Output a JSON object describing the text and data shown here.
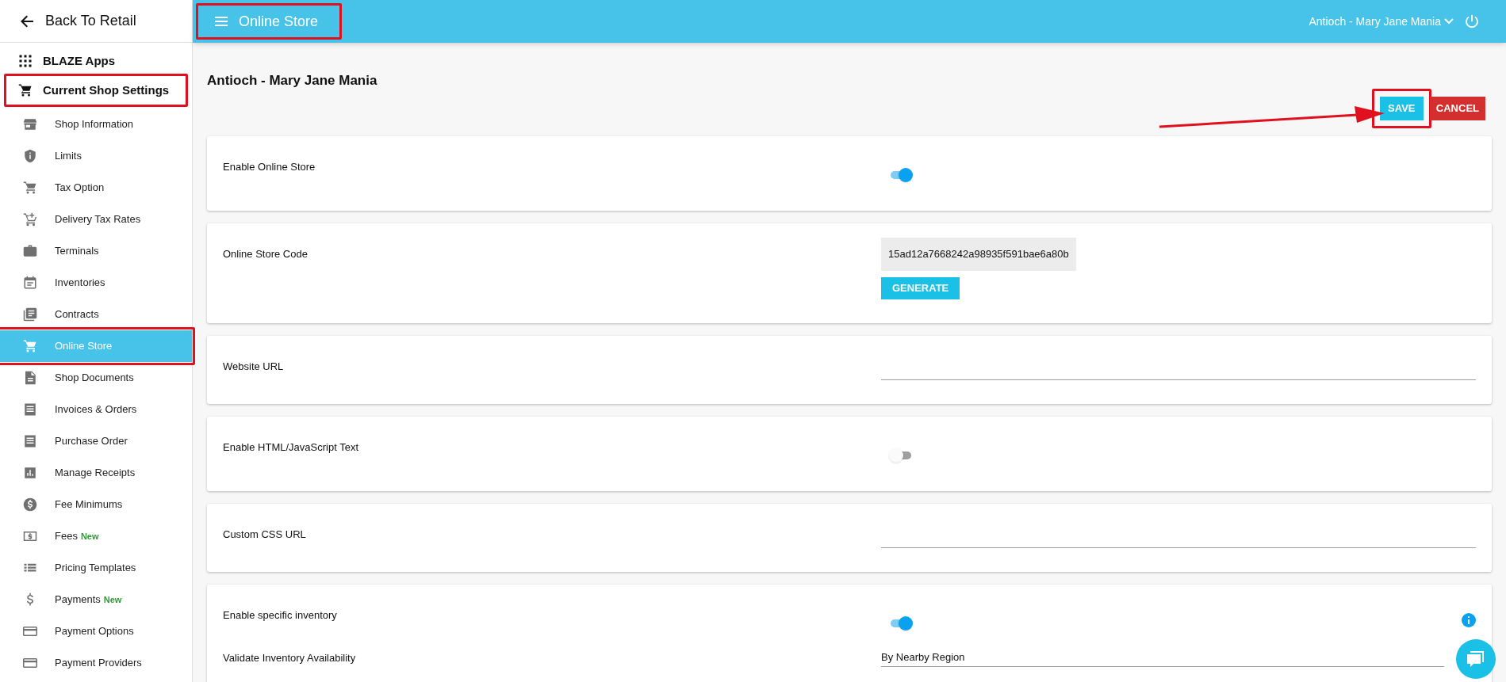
{
  "sidebar": {
    "back_label": "Back To Retail",
    "sections": [
      {
        "label": "BLAZE Apps",
        "highlighted": false
      },
      {
        "label": "Current Shop Settings",
        "highlighted": true
      }
    ],
    "items": [
      {
        "label": "Shop Information",
        "selected": false,
        "highlighted": false
      },
      {
        "label": "Limits",
        "selected": false,
        "highlighted": false
      },
      {
        "label": "Tax Option",
        "selected": false,
        "highlighted": false
      },
      {
        "label": "Delivery Tax Rates",
        "selected": false,
        "highlighted": false
      },
      {
        "label": "Terminals",
        "selected": false,
        "highlighted": false
      },
      {
        "label": "Inventories",
        "selected": false,
        "highlighted": false
      },
      {
        "label": "Contracts",
        "selected": false,
        "highlighted": false
      },
      {
        "label": "Online Store",
        "selected": true,
        "highlighted": true
      },
      {
        "label": "Shop Documents",
        "selected": false,
        "highlighted": false
      },
      {
        "label": "Invoices & Orders",
        "selected": false,
        "highlighted": false
      },
      {
        "label": "Purchase Order",
        "selected": false,
        "highlighted": false
      },
      {
        "label": "Manage Receipts",
        "selected": false,
        "highlighted": false
      },
      {
        "label": "Fee Minimums",
        "selected": false,
        "highlighted": false
      },
      {
        "label": "Fees",
        "selected": false,
        "highlighted": false,
        "badge": "New"
      },
      {
        "label": "Pricing Templates",
        "selected": false,
        "highlighted": false
      },
      {
        "label": "Payments",
        "selected": false,
        "highlighted": false,
        "badge": "New"
      },
      {
        "label": "Payment Options",
        "selected": false,
        "highlighted": false
      },
      {
        "label": "Payment Providers",
        "selected": false,
        "highlighted": false
      }
    ]
  },
  "topbar": {
    "title": "Online Store",
    "title_highlighted": true,
    "shop": "Antioch - Mary Jane Mania"
  },
  "page": {
    "heading": "Antioch - Mary Jane Mania",
    "actions": [
      {
        "label": "SAVE",
        "kind": "primary",
        "highlighted": true
      },
      {
        "label": "CANCEL",
        "kind": "danger",
        "highlighted": false
      }
    ],
    "cards": [
      {
        "rows": [
          {
            "label": "Enable Online Store",
            "kind": "toggle",
            "on": true
          }
        ]
      },
      {
        "rows": [
          {
            "label": "Online Store Code",
            "kind": "code",
            "value": "15ad12a7668242a98935f591bae6a80b",
            "button": "GENERATE"
          }
        ]
      },
      {
        "rows": [
          {
            "label": "Website URL",
            "kind": "text"
          }
        ]
      },
      {
        "rows": [
          {
            "label": "Enable HTML/JavaScript Text",
            "kind": "toggle",
            "on": false
          }
        ]
      },
      {
        "rows": [
          {
            "label": "Custom CSS URL",
            "kind": "text"
          }
        ]
      },
      {
        "rows": [
          {
            "label": "Enable specific inventory",
            "kind": "toggle",
            "on": true,
            "info": true
          },
          {
            "label": "Validate Inventory Availability",
            "kind": "select",
            "value": "By Nearby Region"
          }
        ]
      }
    ]
  }
}
